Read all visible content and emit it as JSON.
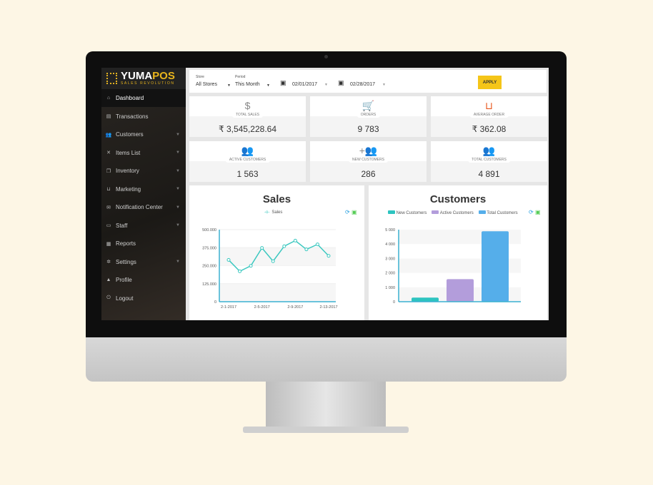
{
  "brand": {
    "name_a": "YUMA",
    "name_b": "POS",
    "tagline": "SALES REVOLUTION"
  },
  "sidebar": {
    "items": [
      {
        "label": "Dashboard",
        "icon": "home-icon",
        "chevron": false
      },
      {
        "label": "Transactions",
        "icon": "clipboard-icon",
        "chevron": false
      },
      {
        "label": "Customers",
        "icon": "people-icon",
        "chevron": true
      },
      {
        "label": "Items List",
        "icon": "tools-icon",
        "chevron": true
      },
      {
        "label": "Inventory",
        "icon": "layers-icon",
        "chevron": true
      },
      {
        "label": "Marketing",
        "icon": "basket-icon",
        "chevron": true
      },
      {
        "label": "Notification Center",
        "icon": "mail-icon",
        "chevron": true
      },
      {
        "label": "Staff",
        "icon": "id-card-icon",
        "chevron": true
      },
      {
        "label": "Reports",
        "icon": "report-icon",
        "chevron": false
      },
      {
        "label": "Settings",
        "icon": "gear-icon",
        "chevron": true
      },
      {
        "label": "Profile",
        "icon": "person-icon",
        "chevron": false
      },
      {
        "label": "Logout",
        "icon": "power-icon",
        "chevron": false
      }
    ]
  },
  "filter": {
    "store_label": "Store",
    "store_value": "All Stores",
    "period_label": "Period",
    "period_value": "This Month",
    "date_from": "02/01/2017",
    "date_to": "02/28/2017",
    "apply": "APPLY"
  },
  "cards": [
    {
      "label": "TOTAL SALES",
      "value": "₹ 3,545,228.64",
      "icon": "dollar-icon",
      "color": "#888888"
    },
    {
      "label": "ORDERS",
      "value": "9 783",
      "icon": "cart-icon",
      "color": "#f5c518"
    },
    {
      "label": "AVERAGE ORDER",
      "value": "₹ 362.08",
      "icon": "basket-icon",
      "color": "#e8561c"
    },
    {
      "label": "ACTIVE CUSTOMERS",
      "value": "1 563",
      "icon": "people-icon",
      "color": "#888888"
    },
    {
      "label": "NEW CUSTOMERS",
      "value": "286",
      "icon": "add-people-icon",
      "color": "#888888"
    },
    {
      "label": "TOTAL CUSTOMERS",
      "value": "4 891",
      "icon": "people-icon",
      "color": "#888888"
    }
  ],
  "chart_data": [
    {
      "type": "line",
      "title": "Sales",
      "series": [
        {
          "name": "Sales",
          "color": "#3cc8c0",
          "values": [
            290000,
            211000,
            249000,
            373000,
            281000,
            385000,
            424000,
            363000,
            398000,
            318000
          ]
        }
      ],
      "x_tick_labels": [
        "2-1-2017",
        "2-5-2017",
        "2-9-2017",
        "2-13-2017"
      ],
      "y_tick_labels": [
        "0",
        "125.000",
        "250.000",
        "375.000",
        "500.000"
      ],
      "ylim": [
        0,
        500000
      ]
    },
    {
      "type": "bar",
      "title": "Customers",
      "categories": [
        "New Customers",
        "Active Customers",
        "Total Customers"
      ],
      "values": [
        286,
        1563,
        4891
      ],
      "colors": [
        "#2ec4c0",
        "#b39ddb",
        "#55aeea"
      ],
      "y_tick_labels": [
        "0",
        "1 000",
        "2 000",
        "3 000",
        "4 000",
        "5 000"
      ],
      "ylim": [
        0,
        5000
      ]
    }
  ]
}
